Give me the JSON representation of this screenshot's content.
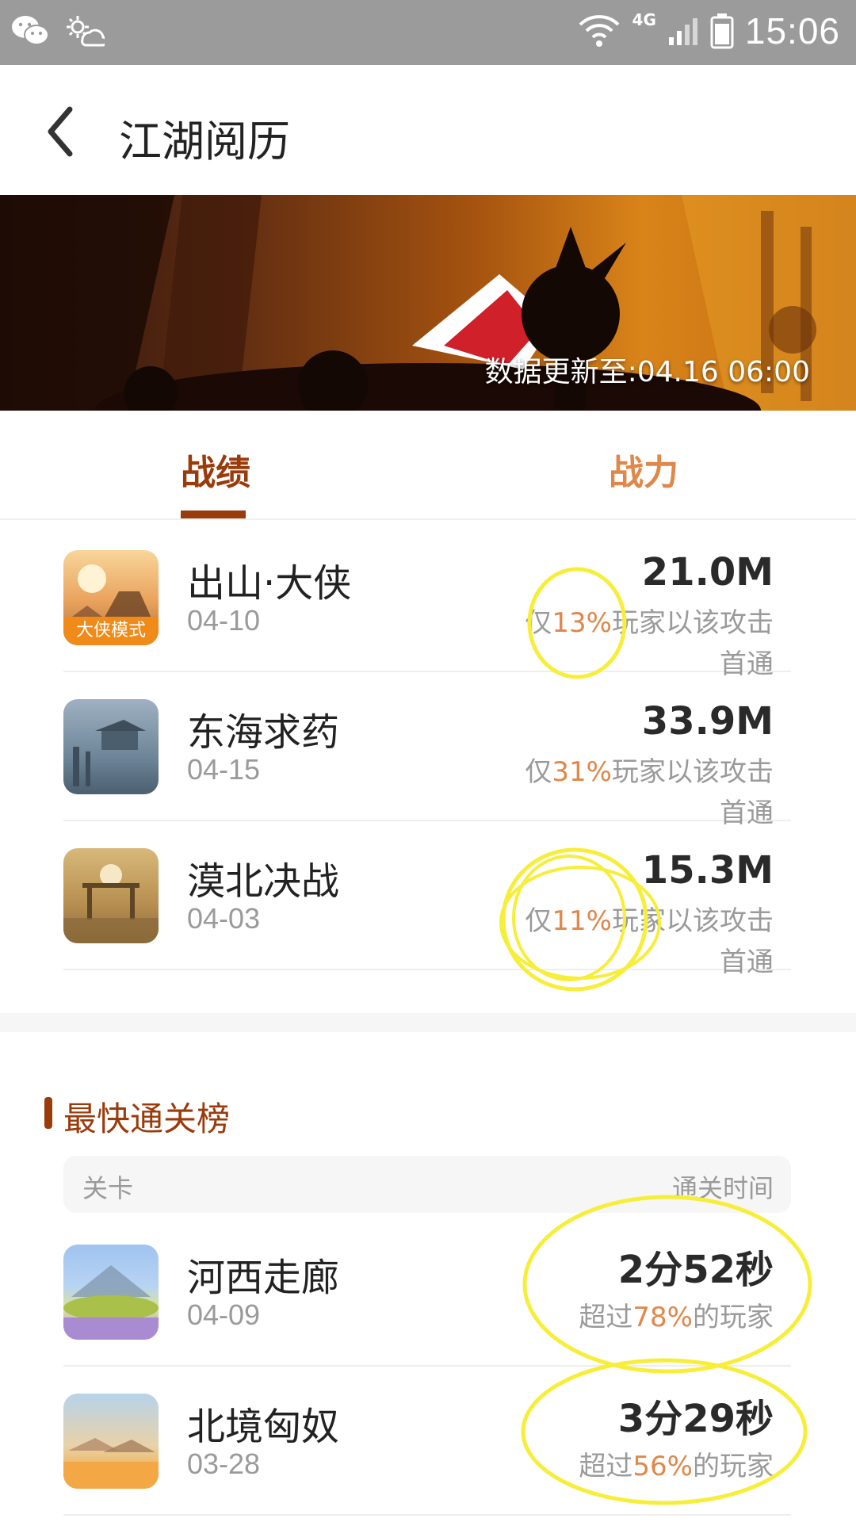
{
  "status_bar": {
    "time": "15:06",
    "network": "4G"
  },
  "header": {
    "title": "江湖阅历"
  },
  "banner": {
    "update_text": "数据更新至:04.16 06:00"
  },
  "tabs": [
    {
      "label": "战绩",
      "active": true
    },
    {
      "label": "战力",
      "active": false
    }
  ],
  "records": [
    {
      "name": "出山·大侠",
      "date": "04-10",
      "score": "21.0M",
      "stat_prefix": "仅",
      "pct": "13%",
      "stat_suffix": "玩家以该攻击",
      "stat_line2": "首通",
      "badge": "大侠模式"
    },
    {
      "name": "东海求药",
      "date": "04-15",
      "score": "33.9M",
      "stat_prefix": "仅",
      "pct": "31%",
      "stat_suffix": "玩家以该攻击",
      "stat_line2": "首通"
    },
    {
      "name": "漠北决战",
      "date": "04-03",
      "score": "15.3M",
      "stat_prefix": "仅",
      "pct": "11%",
      "stat_suffix": "玩家以该攻击",
      "stat_line2": "首通"
    }
  ],
  "fastest": {
    "title": "最快通关榜",
    "head_left": "关卡",
    "head_right": "通关时间",
    "items": [
      {
        "name": "河西走廊",
        "date": "04-09",
        "time": "2分52秒",
        "stat_prefix": "超过",
        "pct": "78%",
        "stat_suffix": "的玩家"
      },
      {
        "name": "北境匈奴",
        "date": "03-28",
        "time": "3分29秒",
        "stat_prefix": "超过",
        "pct": "56%",
        "stat_suffix": "的玩家"
      }
    ]
  },
  "colors": {
    "accent": "#9a3b0c",
    "highlight": "#e0874a",
    "annotation": "#f7ee3a",
    "status_bar": "#9b9b9b"
  }
}
